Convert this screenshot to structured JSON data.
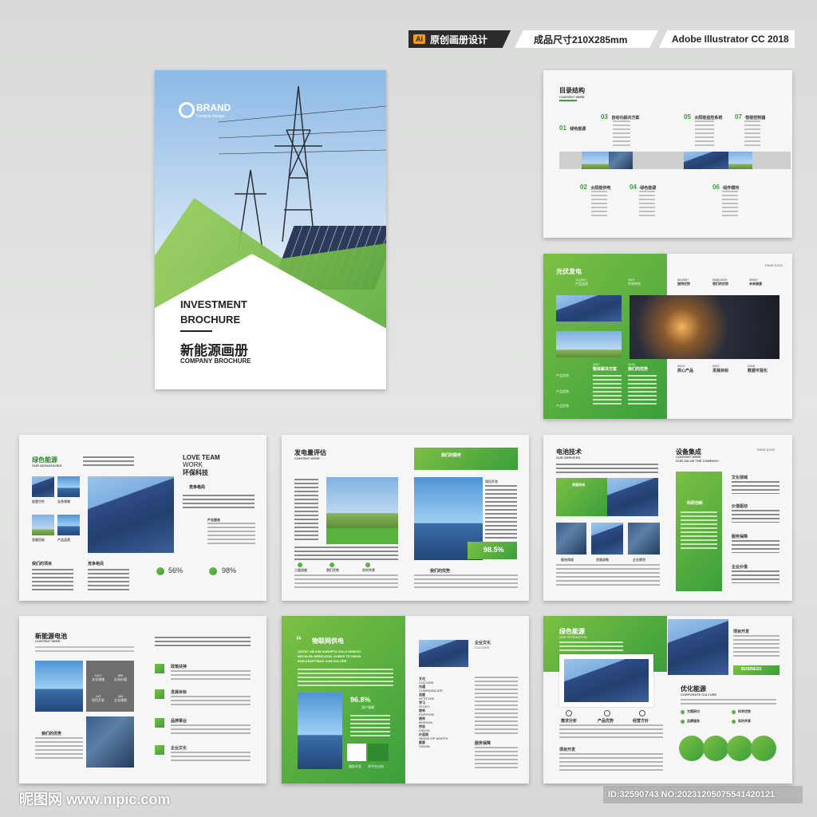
{
  "header": {
    "tag1_icon": "Ai",
    "tag1": "原创画册设计",
    "tag2": "成品尺寸210X285mm",
    "tag3": "Adobe Illustrator CC 2018"
  },
  "cover": {
    "brand": "BRAND",
    "brand_sub": "Creative Design",
    "title1": "INVESTMENT",
    "title2": "BROCHURE",
    "cn_title": "新能源画册",
    "subtitle": "COMPANY BROCHURE"
  },
  "toc": {
    "title": "目录结构",
    "sub": "CONTENT HERE",
    "items": [
      {
        "num": "01",
        "label": "绿色能源"
      },
      {
        "num": "03",
        "label": "自动化解决方案"
      },
      {
        "num": "05",
        "label": "太阳能监控系统"
      },
      {
        "num": "07",
        "label": "智能控制器"
      },
      {
        "num": "02",
        "label": "太阳能供电"
      },
      {
        "num": "04",
        "label": "绿色能源"
      },
      {
        "num": "06",
        "label": "组件模块"
      }
    ]
  },
  "pv": {
    "title": "光伏发电",
    "page": "PAGE 01/02",
    "stats": [
      {
        "value": "16,800+",
        "label": "产品品质"
      },
      {
        "value": "150+",
        "label": "科学研究"
      },
      {
        "value": "45,800+",
        "label": "独特优势"
      },
      {
        "value": "9580,000+",
        "label": "我们的优势"
      },
      {
        "value": "3500+",
        "label": "未来展望"
      }
    ],
    "years": [
      {
        "year": "2007",
        "label": "整体解决方案"
      },
      {
        "year": "2010",
        "label": "我们的优势"
      },
      {
        "year": "2014",
        "label": "核心产品"
      },
      {
        "year": "2017",
        "label": "发展目标"
      },
      {
        "year": "2018",
        "label": "数据可视化"
      }
    ],
    "side": [
      "产品优势",
      "产品优势",
      "产品优势"
    ]
  },
  "green": {
    "title": "绿色能源",
    "sub": "OUR ADVANTAGES",
    "love": "LOVE TEAM",
    "work": "WORK",
    "cn": "环保科技",
    "compete": "竞争格局",
    "biz": "产业服务",
    "labels": [
      "经营方针",
      "业务领域",
      "发展目标",
      "产品品质"
    ],
    "bottom": [
      "我们的项目",
      "竞争格局"
    ],
    "pct1": "56%",
    "pct2": "98%"
  },
  "power": {
    "title": "发电量评估",
    "sub": "CONTENT HERE",
    "banner": "我们的服务",
    "labels": [
      "工程进度",
      "我们优势",
      "实时共享"
    ],
    "side_label": "项目开发",
    "pct": "98.5%",
    "bottom": "我们的优势"
  },
  "battery": {
    "title": "电池技术",
    "sub": "OUR SERVICES",
    "title2": "设备集成",
    "sub2": "CONTENT HERE",
    "sub2b": "OUR VALUE THE COMPANY",
    "page": "PAGE 01/02",
    "box": "资源扶持",
    "center": "科研创新",
    "labels": [
      "服务网络",
      "发展战略",
      "企业规划"
    ],
    "right": [
      "文化领域",
      "价值驱动",
      "服务保障",
      "企业价值"
    ]
  },
  "storage": {
    "title": "新能源电池",
    "sub": "CONTENT HERE",
    "cells": [
      {
        "v": "1207",
        "l": "文化领域"
      },
      {
        "v": "806",
        "l": "企业价值"
      },
      {
        "v": "147",
        "l": "项目开发"
      },
      {
        "v": "484",
        "l": "企业规划"
      }
    ],
    "adv": "我们的优势",
    "right": [
      "政策扶持",
      "发展目标",
      "品牌事业",
      "企业文化"
    ]
  },
  "iot": {
    "title": "物联网供电",
    "latin1": "ADITAT AB IUM HARUPTA VOLO DEBITIO",
    "latin2": "NECULPA DERECATAL AUBUS TE OSION",
    "latin3": "EUM ARUPTIBUS CUM VOLORE",
    "pct": "96.8%",
    "pct_sub": "用户规模",
    "icon1": "服务开发",
    "icon2": "多平台分析",
    "culture_title": "企业文化",
    "culture_sub": "CULTURE",
    "words": [
      {
        "cn": "文化",
        "en": "CULTURE"
      },
      {
        "cn": "沟通",
        "en": "COMMUNICATE"
      },
      {
        "cn": "态度",
        "en": "ATTITUDE"
      },
      {
        "cn": "学习",
        "en": "STUDY"
      },
      {
        "cn": "使命",
        "en": "PURPOSE"
      },
      {
        "cn": "使命",
        "en": "MISSION"
      },
      {
        "cn": "宗旨",
        "en": "VISION"
      },
      {
        "cn": "价值观",
        "en": "SENSE OF WORTH"
      },
      {
        "cn": "愿景",
        "en": "VISION"
      }
    ],
    "service": "服务保障"
  },
  "final": {
    "title": "绿色能源",
    "sub": "OUR STRENGTHS",
    "project": "项目开发",
    "business": "BUSINESS",
    "labels": [
      "需求分析",
      "产品优势",
      "经营方针"
    ],
    "culture": "优化能源",
    "culture_sub": "CORPORATE CULTURE",
    "bullets": [
      "方案研讨",
      "科学优势",
      "品牌服务",
      "实时共享"
    ],
    "bottom": "项目开发"
  },
  "watermark": {
    "left": "昵图网 www.nipic.com",
    "right": "ID:32590743 NO:20231205075541420121"
  }
}
